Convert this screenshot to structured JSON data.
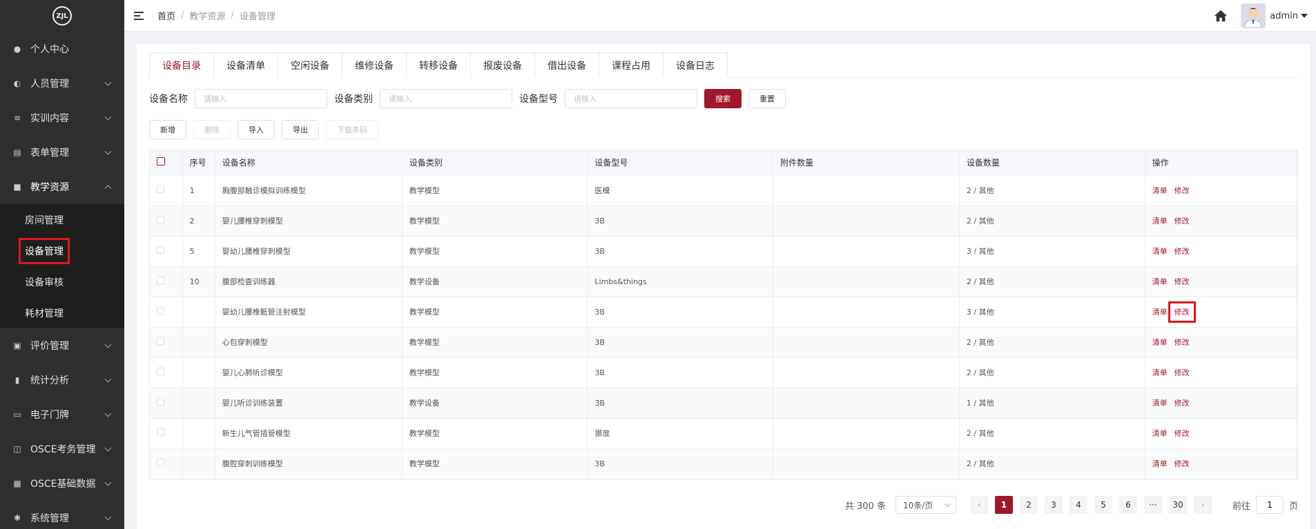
{
  "logo": {
    "text": "ZJL"
  },
  "sidebar": {
    "items": [
      {
        "label": "个人中心",
        "icon": "user-icon"
      },
      {
        "label": "人员管理",
        "icon": "users-icon"
      },
      {
        "label": "实训内容",
        "icon": "book-icon"
      },
      {
        "label": "表单管理",
        "icon": "form-icon"
      },
      {
        "label": "教学资源",
        "icon": "resource-icon"
      },
      {
        "label": "评价管理",
        "icon": "rating-icon"
      },
      {
        "label": "统计分析",
        "icon": "chart-icon"
      },
      {
        "label": "电子门牌",
        "icon": "monitor-icon"
      },
      {
        "label": "OSCE考务管理",
        "icon": "exam-icon"
      },
      {
        "label": "OSCE基础数据",
        "icon": "grid-icon"
      },
      {
        "label": "系统管理",
        "icon": "gear-icon"
      }
    ],
    "sub_items": [
      "房间管理",
      "设备管理",
      "设备审核",
      "耗材管理"
    ]
  },
  "header": {
    "breadcrumb": [
      "首页",
      "教学资源",
      "设备管理"
    ],
    "username": "admin"
  },
  "tabs": [
    "设备目录",
    "设备清单",
    "空闲设备",
    "维修设备",
    "转移设备",
    "报废设备",
    "借出设备",
    "课程占用",
    "设备日志"
  ],
  "filter": {
    "name_label": "设备名称",
    "type_label": "设备类别",
    "model_label": "设备型号",
    "placeholder": "请输入",
    "search": "搜索",
    "reset": "重置"
  },
  "actions": {
    "add": "新增",
    "delete": "删除",
    "import": "导入",
    "export": "导出",
    "download": "下载条码"
  },
  "table": {
    "headers": [
      "序号",
      "设备名称",
      "设备类别",
      "设备型号",
      "附件数量",
      "设备数量",
      "操作"
    ],
    "rows": [
      {
        "no": "1",
        "name": "胸腹部触诊模拟训练模型",
        "type": "教学模型",
        "model": "医模",
        "attach": "",
        "qty": "2 / 其他"
      },
      {
        "no": "2",
        "name": "婴儿腰椎穿刺模型",
        "type": "教学模型",
        "model": "3B",
        "attach": "",
        "qty": "2 / 其他"
      },
      {
        "no": "5",
        "name": "婴幼儿腰椎穿刺模型",
        "type": "教学模型",
        "model": "3B",
        "attach": "",
        "qty": "3 / 其他"
      },
      {
        "no": "10",
        "name": "腹部检查训练器",
        "type": "教学设备",
        "model": "Limbs&things",
        "attach": "",
        "qty": "2 / 其他"
      },
      {
        "no": "",
        "name": "婴幼儿腰椎骶管注射模型",
        "type": "教学模型",
        "model": "3B",
        "attach": "",
        "qty": "3 / 其他"
      },
      {
        "no": "",
        "name": "心包穿刺模型",
        "type": "教学模型",
        "model": "3B",
        "attach": "",
        "qty": "2 / 其他"
      },
      {
        "no": "",
        "name": "婴儿心肺听诊模型",
        "type": "教学模型",
        "model": "3B",
        "attach": "",
        "qty": "2 / 其他"
      },
      {
        "no": "",
        "name": "婴儿听诊训练装置",
        "type": "教学设备",
        "model": "3B",
        "attach": "",
        "qty": "1 / 其他"
      },
      {
        "no": "",
        "name": "新生儿气管插管模型",
        "type": "教学模型",
        "model": "挪度",
        "attach": "",
        "qty": "2 / 其他"
      },
      {
        "no": "",
        "name": "腹腔穿刺训练模型",
        "type": "教学模型",
        "model": "3B",
        "attach": "",
        "qty": "2 / 其他"
      }
    ],
    "op_list": "清单",
    "op_edit": "修改"
  },
  "pager": {
    "total": "共 300 条",
    "size": "10条/页",
    "pages": [
      "1",
      "2",
      "3",
      "4",
      "5",
      "6",
      "···",
      "30"
    ],
    "goto_prefix": "前往",
    "goto_value": "1",
    "goto_suffix": "页"
  }
}
